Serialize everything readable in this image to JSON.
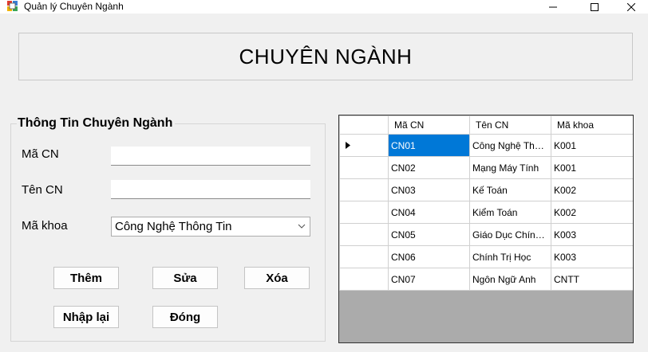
{
  "window": {
    "title": "Quản lý Chuyên Ngành"
  },
  "header": {
    "title": "CHUYÊN NGÀNH"
  },
  "form": {
    "group_title": "Thông Tin Chuyên Ngành",
    "ma_cn_label": "Mã CN",
    "ma_cn_value": "",
    "ten_cn_label": "Tên CN",
    "ten_cn_value": "",
    "ma_khoa_label": "Mã khoa",
    "ma_khoa_selected": "Công Nghệ Thông Tin"
  },
  "buttons": {
    "them": "Thêm",
    "sua": "Sửa",
    "xoa": "Xóa",
    "nhap_lai": "Nhập lại",
    "dong": "Đóng"
  },
  "grid": {
    "columns": [
      "Mã CN",
      "Tên CN",
      "Mã khoa"
    ],
    "rows": [
      [
        "CN01",
        "Công Nghệ Thôn...",
        "K001"
      ],
      [
        "CN02",
        "Mạng Máy Tính",
        "K001"
      ],
      [
        "CN03",
        "Kế Toán",
        "K002"
      ],
      [
        "CN04",
        "Kiểm Toán",
        "K002"
      ],
      [
        "CN05",
        "Giáo Dục Chính Trị",
        "K003"
      ],
      [
        "CN06",
        "Chính Trị Học",
        "K003"
      ],
      [
        "CN07",
        "Ngôn Ngữ Anh",
        "CNTT"
      ]
    ],
    "selected_row": 0
  },
  "colors": {
    "selection": "#0078d7",
    "grid_background": "#ababab",
    "window_background": "#f0f0f0"
  }
}
